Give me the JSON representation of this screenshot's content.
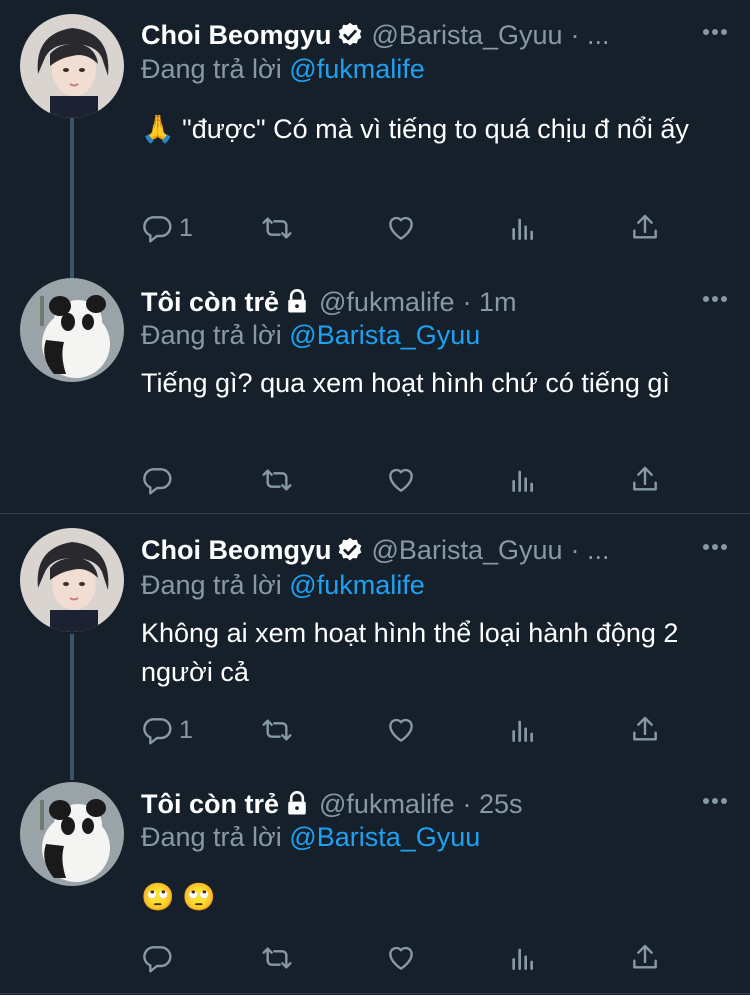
{
  "tweets": [
    {
      "name": "Choi Beomgyu",
      "handle": "@Barista_Gyuu",
      "time": "· ...",
      "replying_prefix": "Đang trả lời",
      "replying_to": "@fukmalife",
      "text": "🙏 \"được\" Có mà vì tiếng to quá chịu đ nổi ấy",
      "reply_count": "1",
      "verified": true,
      "locked": false,
      "avatar": "boy-avatar"
    },
    {
      "name": "Tôi còn trẻ",
      "handle": "@fukmalife",
      "time": "· 1m",
      "replying_prefix": "Đang trả lời",
      "replying_to": "@Barista_Gyuu",
      "text": "Tiếng gì? qua xem hoạt hình chứ có tiếng gì",
      "reply_count": "",
      "verified": false,
      "locked": true,
      "avatar": "panda-avatar"
    },
    {
      "name": "Choi Beomgyu",
      "handle": "@Barista_Gyuu",
      "time": "· ...",
      "replying_prefix": "Đang trả lời",
      "replying_to": "@fukmalife",
      "text": "Không ai xem hoạt hình thể loại hành động 2 người cả",
      "reply_count": "1",
      "verified": true,
      "locked": false,
      "avatar": "boy-avatar"
    },
    {
      "name": "Tôi còn trẻ",
      "handle": "@fukmalife",
      "time": "· 25s",
      "replying_prefix": "Đang trả lời",
      "replying_to": "@Barista_Gyuu",
      "text": "🙄 🙄",
      "reply_count": "",
      "verified": false,
      "locked": true,
      "avatar": "panda-avatar"
    }
  ],
  "icons": {
    "reply": "reply-icon",
    "retweet": "retweet-icon",
    "like": "like-icon",
    "analytics": "analytics-icon",
    "share": "share-icon",
    "more": "more-icon",
    "verified": "verified-badge-icon",
    "lock": "lock-icon"
  },
  "colors": {
    "background": "#15202b",
    "text": "#ffffff",
    "secondary": "#8899a6",
    "accent": "#1da1f2",
    "thread_line": "#3d5466",
    "divider": "#38444d"
  }
}
